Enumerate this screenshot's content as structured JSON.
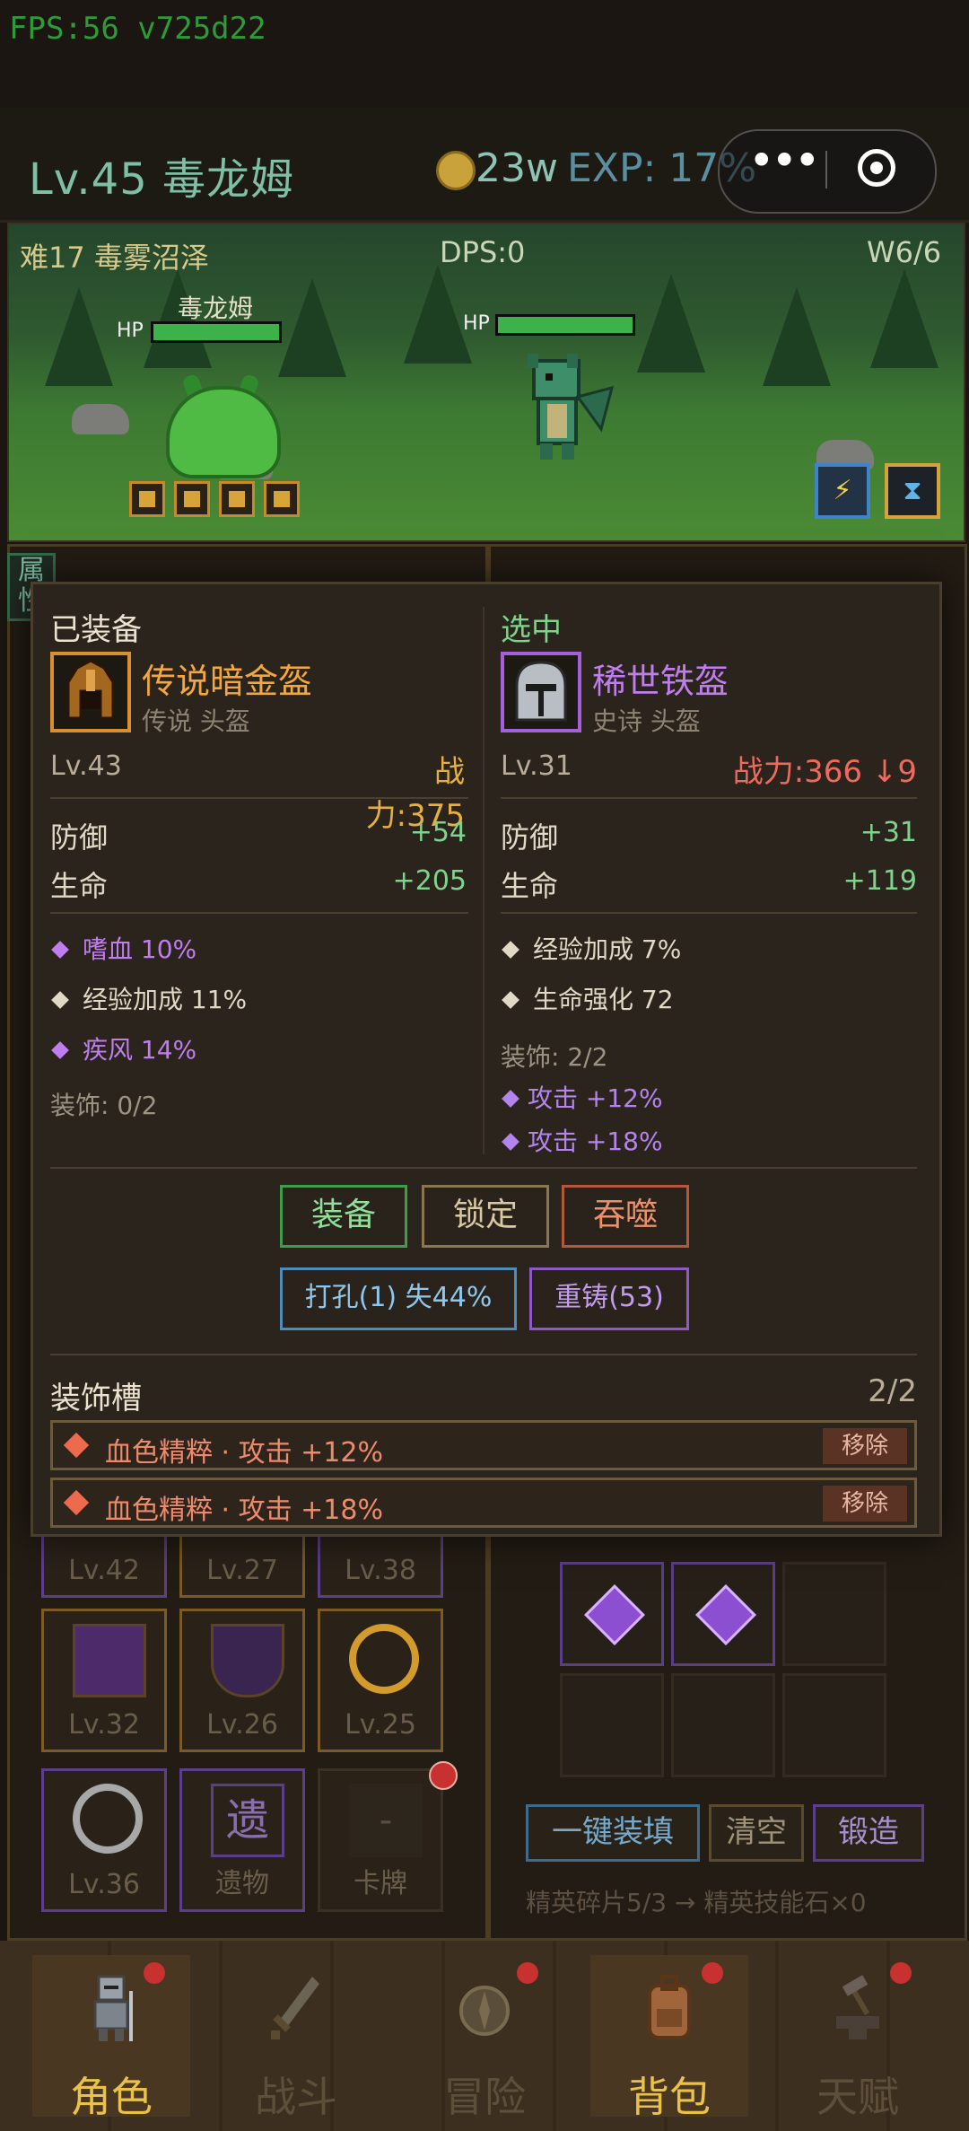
{
  "hud": {
    "fps": "FPS:56 v725d22",
    "player_name": "Lv.45 毒龙姆",
    "gold": "23w",
    "exp": "EXP: 17%"
  },
  "battle": {
    "stage": "难17 毒雾沼泽",
    "dps": "DPS:0",
    "wave": "W6/6",
    "player_label": "毒龙姆",
    "hp_label": "HP",
    "player_hp_fraction": 1.0,
    "enemy_hp_fraction": 1.0
  },
  "background": {
    "side_tab": "属\n性",
    "inventory_levels": [
      "Lv.42",
      "Lv.27",
      "Lv.38",
      "Lv.32",
      "Lv.26",
      "Lv.25",
      "Lv.36"
    ],
    "relic_label": "遗物",
    "relic_glyph": "遗",
    "card_label": "卡牌",
    "card_glyph": "-",
    "fill_all": "一键装填",
    "clear": "清空",
    "forge": "锻造",
    "shards": "精英碎片5/3 → 精英技能石×0"
  },
  "compare": {
    "equipped": {
      "title": "已装备",
      "name": "传说暗金盔",
      "subtitle": "传说 头盔",
      "level": "Lv.43",
      "power": "战力:375",
      "stats": [
        {
          "name": "防御",
          "value": "+54"
        },
        {
          "name": "生命",
          "value": "+205"
        }
      ],
      "affixes": [
        {
          "text": "嗜血 10%",
          "rarity": "purple"
        },
        {
          "text": "经验加成 11%",
          "rarity": "white"
        },
        {
          "text": "疾风 14%",
          "rarity": "purple"
        }
      ],
      "socket_note": "装饰: 0/2"
    },
    "selected": {
      "title": "选中",
      "name": "稀世铁盔",
      "subtitle": "史诗 头盔",
      "level": "Lv.31",
      "power": "战力:366 ↓9",
      "stats": [
        {
          "name": "防御",
          "value": "+31"
        },
        {
          "name": "生命",
          "value": "+119"
        }
      ],
      "affixes": [
        {
          "text": "经验加成 7%",
          "rarity": "white"
        },
        {
          "text": "生命强化 72",
          "rarity": "white"
        }
      ],
      "socket_note": "装饰: 2/2",
      "socket_lines": [
        "攻击 +12%",
        "攻击 +18%"
      ]
    },
    "buttons": {
      "equip": "装备",
      "lock": "锁定",
      "devour": "吞噬",
      "socket": "打孔(1) 失44%",
      "reforge": "重铸(53)"
    },
    "socket_section": {
      "title": "装饰槽",
      "count": "2/2",
      "rows": [
        {
          "text": "血色精粹 · 攻击 +12%",
          "remove": "移除"
        },
        {
          "text": "血色精粹 · 攻击 +18%",
          "remove": "移除"
        }
      ]
    }
  },
  "nav": {
    "items": [
      {
        "label": "角色",
        "active": true,
        "dot": true
      },
      {
        "label": "战斗",
        "active": false,
        "dot": false
      },
      {
        "label": "冒险",
        "active": false,
        "dot": true
      },
      {
        "label": "背包",
        "active": true,
        "dot": true
      },
      {
        "label": "天赋",
        "active": false,
        "dot": true
      }
    ]
  },
  "colors": {
    "legendary": "#f3a73c",
    "epic": "#c07df0",
    "positive": "#7fd48d",
    "negative": "#ee6a5e"
  }
}
